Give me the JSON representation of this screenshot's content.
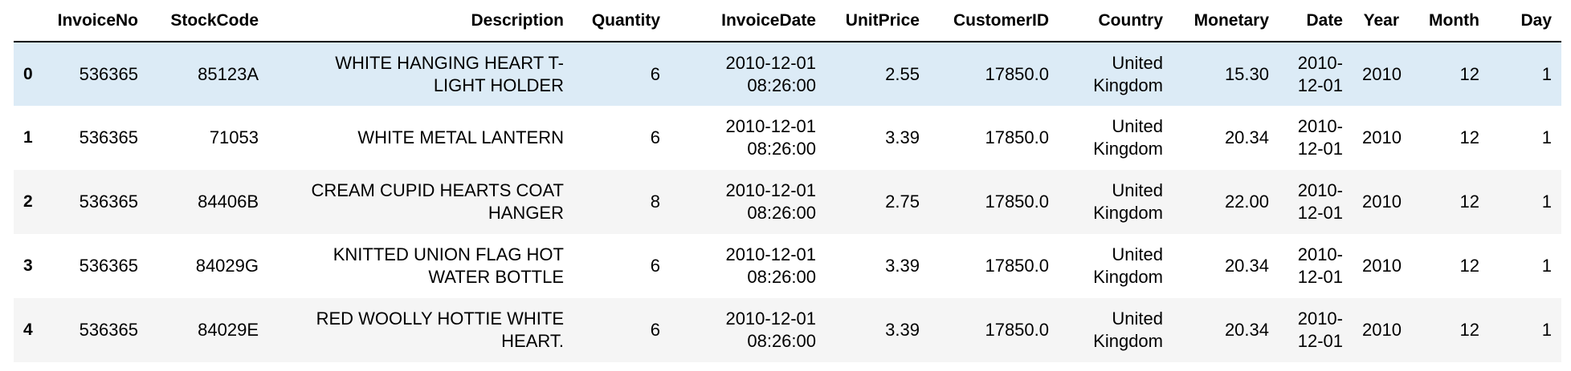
{
  "table": {
    "columns": [
      "",
      "InvoiceNo",
      "StockCode",
      "Description",
      "Quantity",
      "InvoiceDate",
      "UnitPrice",
      "CustomerID",
      "Country",
      "Monetary",
      "Date",
      "Year",
      "Month",
      "Day"
    ],
    "rows": [
      {
        "index": "0",
        "InvoiceNo": "536365",
        "StockCode": "85123A",
        "Description_1": "WHITE HANGING HEART T-",
        "Description_2": "LIGHT HOLDER",
        "Quantity": "6",
        "InvoiceDate_1": "2010-12-01",
        "InvoiceDate_2": "08:26:00",
        "UnitPrice": "2.55",
        "CustomerID": "17850.0",
        "Country_1": "United",
        "Country_2": "Kingdom",
        "Monetary": "15.30",
        "Date_1": "2010-",
        "Date_2": "12-01",
        "Year": "2010",
        "Month": "12",
        "Day": "1",
        "highlighted": true
      },
      {
        "index": "1",
        "InvoiceNo": "536365",
        "StockCode": "71053",
        "Description_1": "WHITE METAL LANTERN",
        "Description_2": "",
        "Quantity": "6",
        "InvoiceDate_1": "2010-12-01",
        "InvoiceDate_2": "08:26:00",
        "UnitPrice": "3.39",
        "CustomerID": "17850.0",
        "Country_1": "United",
        "Country_2": "Kingdom",
        "Monetary": "20.34",
        "Date_1": "2010-",
        "Date_2": "12-01",
        "Year": "2010",
        "Month": "12",
        "Day": "1"
      },
      {
        "index": "2",
        "InvoiceNo": "536365",
        "StockCode": "84406B",
        "Description_1": "CREAM CUPID HEARTS COAT",
        "Description_2": "HANGER",
        "Quantity": "8",
        "InvoiceDate_1": "2010-12-01",
        "InvoiceDate_2": "08:26:00",
        "UnitPrice": "2.75",
        "CustomerID": "17850.0",
        "Country_1": "United",
        "Country_2": "Kingdom",
        "Monetary": "22.00",
        "Date_1": "2010-",
        "Date_2": "12-01",
        "Year": "2010",
        "Month": "12",
        "Day": "1"
      },
      {
        "index": "3",
        "InvoiceNo": "536365",
        "StockCode": "84029G",
        "Description_1": "KNITTED UNION FLAG HOT",
        "Description_2": "WATER BOTTLE",
        "Quantity": "6",
        "InvoiceDate_1": "2010-12-01",
        "InvoiceDate_2": "08:26:00",
        "UnitPrice": "3.39",
        "CustomerID": "17850.0",
        "Country_1": "United",
        "Country_2": "Kingdom",
        "Monetary": "20.34",
        "Date_1": "2010-",
        "Date_2": "12-01",
        "Year": "2010",
        "Month": "12",
        "Day": "1"
      },
      {
        "index": "4",
        "InvoiceNo": "536365",
        "StockCode": "84029E",
        "Description_1": "RED WOOLLY HOTTIE WHITE",
        "Description_2": "HEART.",
        "Quantity": "6",
        "InvoiceDate_1": "2010-12-01",
        "InvoiceDate_2": "08:26:00",
        "UnitPrice": "3.39",
        "CustomerID": "17850.0",
        "Country_1": "United",
        "Country_2": "Kingdom",
        "Monetary": "20.34",
        "Date_1": "2010-",
        "Date_2": "12-01",
        "Year": "2010",
        "Month": "12",
        "Day": "1"
      }
    ]
  },
  "colors": {
    "stripe": "#f5f5f5",
    "hover": "#dcebf6",
    "header_rule": "#000000"
  }
}
